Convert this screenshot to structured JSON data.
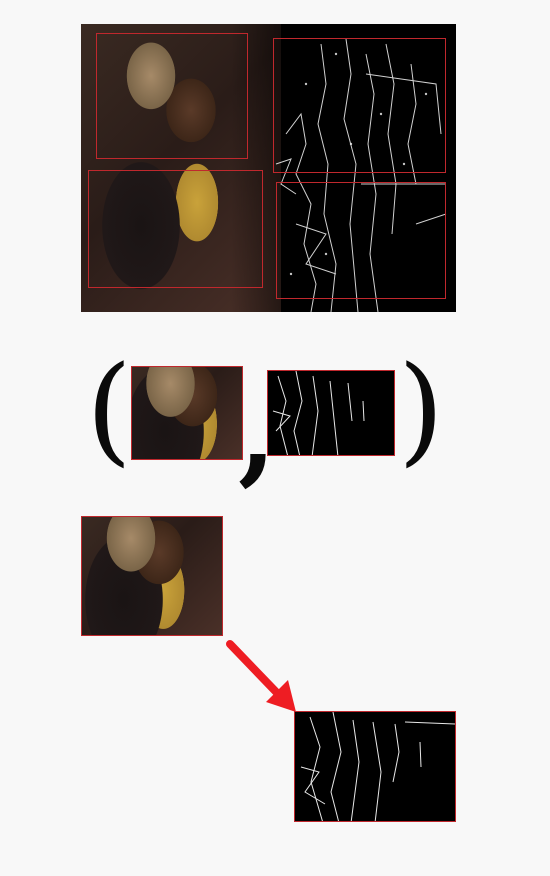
{
  "figure": {
    "tuple_open": "(",
    "tuple_separator": ",",
    "tuple_close": ")",
    "colors": {
      "box": "#c0282d",
      "arrow": "#ee1d23",
      "edge_background": "#000000",
      "edge_lines": "#e8e8e8"
    },
    "panels": {
      "top_composite": "photo-with-edge-map",
      "pair_left": "photo-crop",
      "pair_right": "edge-map-crop",
      "mapping_source": "photo-crop",
      "mapping_target": "edge-map-crop"
    }
  }
}
